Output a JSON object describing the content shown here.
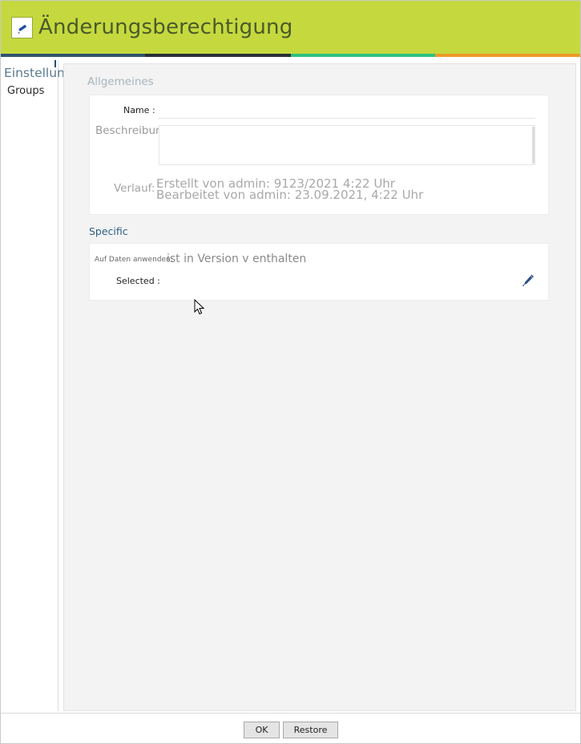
{
  "window": {
    "title": "Änderungsberechtigung",
    "title_icon": "pencil-icon"
  },
  "colors": {
    "titlebar": "#c5d93e",
    "stripe": [
      "#2e5470",
      "#2b2f35",
      "#2ec27e",
      "#ee9a2a"
    ],
    "accent": "#2d5f85"
  },
  "sidebar": {
    "heading": "Einstellungen",
    "items": [
      {
        "label": "Groups"
      }
    ]
  },
  "general": {
    "section_title": "Allgemeines",
    "name_label": "Name :",
    "name_value": "",
    "description_label": "Beschreibung",
    "description_value": "",
    "history_label": "Verlauf:",
    "history_created": "Erstellt von admin: 9123/2021 4:22 Uhr",
    "history_edited": "Bearbeitet von admin: 23.09.2021, 4:22 Uhr"
  },
  "specific": {
    "section_title": "Specific",
    "apply_label": "Auf Daten anwenden:",
    "apply_value": "ist in Version v enthalten",
    "selected_label": "Selected :",
    "selected_value": "",
    "edit_icon": "pencil-icon"
  },
  "footer": {
    "ok_label": "OK",
    "restore_label": "Restore"
  }
}
